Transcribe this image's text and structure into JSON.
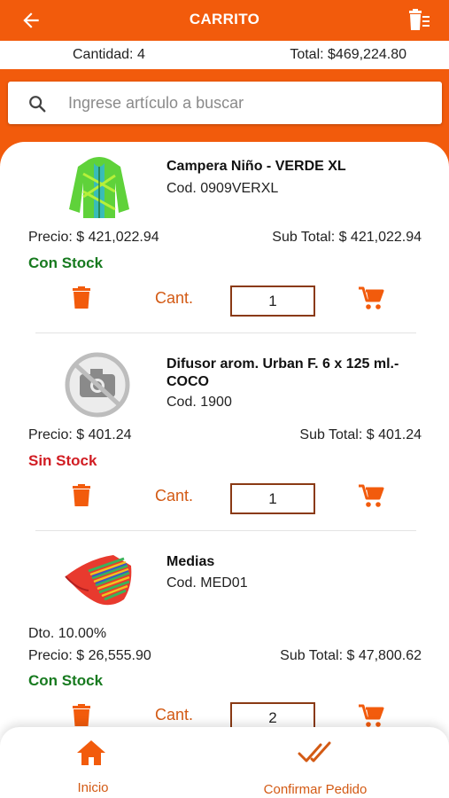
{
  "header": {
    "title": "CARRITO"
  },
  "summary": {
    "quantity": "Cantidad: 4",
    "total": "Total: $469,224.80"
  },
  "search": {
    "placeholder": "Ingrese artículo a buscar"
  },
  "items": [
    {
      "name": "Campera Niño - VERDE XL",
      "code": "Cod. 0909VERXL",
      "price": "Precio: $ 421,022.94",
      "subtotal": "Sub Total: $ 421,022.94",
      "discount": "",
      "stock": "Con Stock",
      "cant_label": "Cant.",
      "qty": "1"
    },
    {
      "name": "Difusor arom. Urban F. 6 x 125 ml.- COCO",
      "code": "Cod. 1900",
      "price": "Precio: $ 401.24",
      "subtotal": "Sub Total: $ 401.24",
      "discount": "",
      "stock": "Sin Stock",
      "cant_label": "Cant.",
      "qty": "1"
    },
    {
      "name": "Medias",
      "code": "Cod. MED01",
      "price": "Precio: $ 26,555.90",
      "subtotal": "Sub Total: $ 47,800.62",
      "discount": "Dto. 10.00%",
      "stock": "Con Stock",
      "cant_label": "Cant.",
      "qty": "2"
    }
  ],
  "bottom_nav": {
    "home": "Inicio",
    "confirm": "Confirmar Pedido"
  },
  "colors": {
    "accent": "#f25b0c",
    "stock_ok": "#177a1f",
    "stock_no": "#d11d23",
    "label": "#d35a14"
  }
}
